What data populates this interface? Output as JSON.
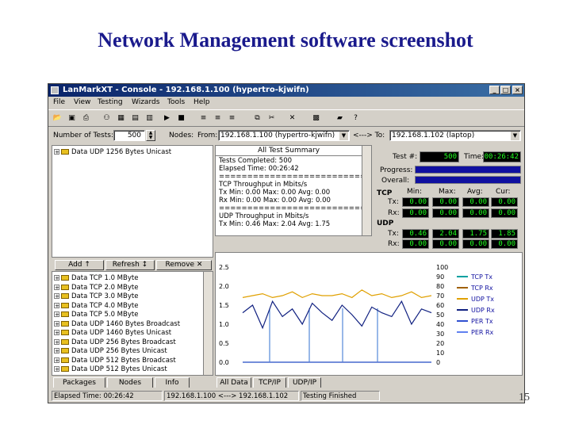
{
  "slide": {
    "title": "Network Management software screenshot",
    "page_number": "15"
  },
  "window": {
    "title": "LanMarkXT - Console - 192.168.1.100 (hypertro-kjwifn)",
    "controls": [
      "_",
      "□",
      "×"
    ]
  },
  "menu": [
    "File",
    "View",
    "Testing",
    "Wizards",
    "Tools",
    "Help"
  ],
  "controls": {
    "num_tests_label": "Number of Tests:",
    "num_tests_value": "500",
    "nodes_label": "Nodes:",
    "from_label": "From:",
    "from_value": "192.168.1.100 (hypertro-kjwifn)",
    "arrow_label": "<---> To:",
    "to_value": "192.168.1.102 (laptop)"
  },
  "top_tree": {
    "items": [
      "Data UDP 1256 Bytes Unicast"
    ]
  },
  "summary": {
    "title": "All Test Summary",
    "lines": [
      "Tests Completed: 500",
      "Elapsed Time: 00:26:42",
      "==================================",
      "TCP Throughput in Mbits/s",
      "Tx    Min: 0.00  Max: 0.00  Avg: 0.00",
      "Rx    Min: 0.00  Max: 0.00  Avg: 0.00",
      "==================================",
      "UDP Throughput in Mbits/s",
      "Tx    Min: 0.46  Max: 2.04  Avg: 1.75"
    ]
  },
  "stats": {
    "test_label": "Test #:",
    "test_value": "500",
    "time_label": "Time:",
    "time_value": "00:26:42",
    "progress_label": "Progress:",
    "progress": 1.0,
    "overall_label": "Overall:",
    "overall": 1.0,
    "headers": [
      "Min:",
      "Max:",
      "Avg:",
      "Cur:"
    ],
    "tcp_label": "TCP",
    "udp_label": "UDP",
    "tx_label": "Tx:",
    "rx_label": "Rx:",
    "tcp_tx": [
      "0.00",
      "0.00",
      "0.00",
      "0.00"
    ],
    "tcp_rx": [
      "0.00",
      "0.00",
      "0.00",
      "0.00"
    ],
    "udp_tx": [
      "0.46",
      "2.04",
      "1.75",
      "1.85"
    ],
    "udp_rx": [
      "0.00",
      "0.00",
      "0.00",
      "0.00"
    ]
  },
  "buttons": {
    "add": "Add ↑",
    "refresh": "Refresh ↕",
    "remove": "Remove ✕"
  },
  "test_list": [
    "Data TCP 1.0 MByte",
    "Data TCP 2.0 MByte",
    "Data TCP 3.0 MByte",
    "Data TCP 4.0 MByte",
    "Data TCP 5.0 MByte",
    "Data UDP 1460 Bytes Broadcast",
    "Data UDP 1460 Bytes Unicast",
    "Data UDP 256 Bytes Broadcast",
    "Data UDP 256 Bytes Unicast",
    "Data UDP 512 Bytes Broadcast",
    "Data UDP 512 Bytes Unicast"
  ],
  "left_tabs": [
    "Packages",
    "Nodes",
    "Info"
  ],
  "chart_tabs": [
    "All Data",
    "TCP/IP",
    "UDP/IP"
  ],
  "chart_data": {
    "type": "line",
    "y_left_ticks": [
      "2.5",
      "2.0",
      "1.5",
      "1.0",
      "0.5",
      "0.0"
    ],
    "y_left_range": [
      0,
      2.5
    ],
    "y_right_ticks": [
      "100",
      "90",
      "80",
      "70",
      "60",
      "50",
      "40",
      "30",
      "20",
      "10",
      "0"
    ],
    "y_right_range": [
      0,
      100
    ],
    "series": [
      {
        "name": "TCP Tx",
        "color": "#00a0a0",
        "values": [
          0,
          0,
          0,
          0,
          0,
          0,
          0,
          0,
          0,
          0
        ]
      },
      {
        "name": "TCP Rx",
        "color": "#a06000",
        "values": [
          0,
          0,
          0,
          0,
          0,
          0,
          0,
          0,
          0,
          0
        ]
      },
      {
        "name": "UDP Tx",
        "color": "#e0a000",
        "values": [
          1.7,
          1.75,
          1.8,
          1.7,
          1.75,
          1.85,
          1.7,
          1.8,
          1.75,
          1.75,
          1.8,
          1.7,
          1.9,
          1.75,
          1.8,
          1.7,
          1.75,
          1.85,
          1.7,
          1.75
        ]
      },
      {
        "name": "UDP Rx",
        "color": "#102080",
        "values": [
          1.3,
          1.5,
          0.9,
          1.6,
          1.2,
          1.4,
          1.0,
          1.55,
          1.3,
          1.1,
          1.5,
          1.25,
          0.95,
          1.45,
          1.3,
          1.2,
          1.6,
          1.0,
          1.4,
          1.3
        ]
      },
      {
        "name": "PER Tx",
        "color": "#3050d0",
        "values": [
          0,
          0,
          0,
          0,
          0,
          0,
          0,
          0,
          0,
          0
        ]
      },
      {
        "name": "PER Rx",
        "color": "#6080f0",
        "values": [
          0,
          0,
          0,
          0,
          0,
          0,
          0,
          0,
          0,
          0
        ]
      }
    ]
  },
  "status": {
    "elapsed": "Elapsed Time: 00:26:42",
    "nodes": "192.168.1.100 <---> 192.168.1.102",
    "state": "Testing Finished"
  },
  "colors": {
    "title_blue": "#1a1a8c",
    "lcd_green": "#20ff20",
    "bar_blue": "#1010a0"
  }
}
